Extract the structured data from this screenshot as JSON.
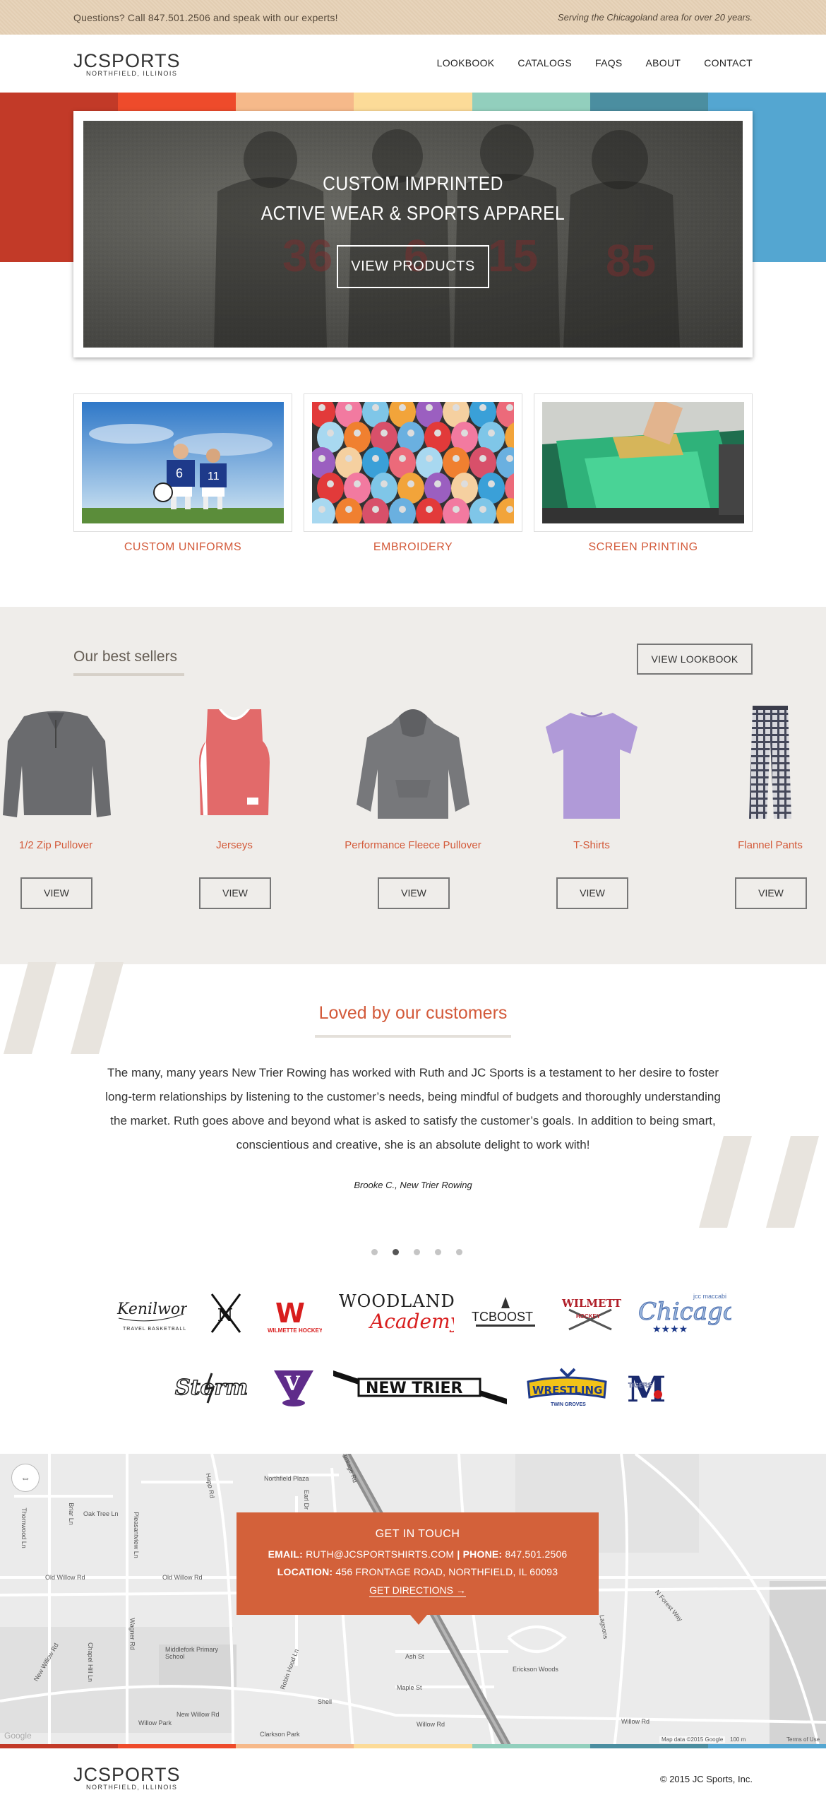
{
  "topbar": {
    "left_text": "Questions? Call 847.501.2506 and speak with our experts!",
    "right_text": "Serving the Chicagoland area for over 20 years."
  },
  "logo": {
    "main": "JCSPORTS",
    "sub": "NORTHFIELD, ILLINOIS"
  },
  "nav": [
    "LOOKBOOK",
    "CATALOGS",
    "FAQS",
    "ABOUT",
    "CONTACT"
  ],
  "stripe_colors": [
    "#c23a28",
    "#ee4b2b",
    "#f6b98a",
    "#fcdb98",
    "#92cfbd",
    "#4b8ea0",
    "#54a6d1"
  ],
  "hero": {
    "title_line1": "CUSTOM IMPRINTED",
    "title_line2": "ACTIVE WEAR & SPORTS APPAREL",
    "button": "VIEW PRODUCTS"
  },
  "services": [
    {
      "label": "CUSTOM UNIFORMS",
      "icon": "soccer-kids-image"
    },
    {
      "label": "EMBROIDERY",
      "icon": "thread-spools-image"
    },
    {
      "label": "SCREEN PRINTING",
      "icon": "screen-print-image"
    }
  ],
  "best_sellers": {
    "title": "Our best sellers",
    "lookbook_button": "VIEW LOOKBOOK",
    "products": [
      {
        "name": "1/2 Zip Pullover",
        "button": "VIEW"
      },
      {
        "name": "Jerseys",
        "button": "VIEW"
      },
      {
        "name": "Performance Fleece Pullover",
        "button": "VIEW"
      },
      {
        "name": "T-Shirts",
        "button": "VIEW"
      },
      {
        "name": "Flannel Pants",
        "button": "VIEW"
      }
    ]
  },
  "testimonial": {
    "title": "Loved by our customers",
    "text": "The many, many years New Trier Rowing has worked with Ruth and JC Sports is a testament to her desire to foster long-term relationships by listening to the customer’s needs, being mindful of budgets and thoroughly understanding the market. Ruth goes above and beyond what is asked to satisfy the customer’s goals. In addition to being smart, conscientious and creative, she is an absolute delight to work with!",
    "author": "Brooke C., New Trier Rowing",
    "active_slide": 2,
    "slide_count": 5
  },
  "clients": {
    "row1": [
      "Kenilworth",
      "TRAVEL BASKETBALL",
      "N",
      "W",
      "WILMETTE HOCKEY",
      "WOODLANDS",
      "Academy",
      "TCBOOST",
      "WILMETTE",
      "HOCKEY",
      "Chicago",
      "jcc maccabi"
    ],
    "row2": [
      "Storm",
      "V",
      "NEW TRIER",
      "WRESTLING",
      "TWIN GROVES",
      "M",
      "TIGERS"
    ]
  },
  "map": {
    "streets": [
      "Northfield Plaza",
      "Frontage Rd",
      "Happ Rd",
      "Briar Ln",
      "Oak Tree Ln",
      "Thornwood Ln",
      "Pleasantview Ln",
      "Old Willow Rd",
      "Old Willow Rd",
      "New Willow Rd",
      "Chapel Hill Ln",
      "Wagner Rd",
      "Middlefork Primary School",
      "Robin Hood Ln",
      "Ash St",
      "Maple St",
      "Shell",
      "New Willow Rd",
      "Willow Rd",
      "Erickson Woods",
      "Willow Rd",
      "N Forest Way",
      "Lagoons",
      "Clarkson Park",
      "Willow Park",
      "Earl Dr"
    ],
    "attribution": "Map data ©2015 Google",
    "scale": "100 m",
    "terms": "Terms of Use",
    "google": "Google"
  },
  "contact": {
    "heading": "GET IN TOUCH",
    "email_label": "EMAIL:",
    "email": "RUTH@JCSPORTSHIRTS.COM",
    "separator": "|",
    "phone_label": "PHONE:",
    "phone": "847.501.2506",
    "location_label": "LOCATION:",
    "location": "456 FRONTAGE ROAD, NORTHFIELD, IL 60093",
    "directions": "GET DIRECTIONS →"
  },
  "footer": {
    "copyright": "© 2015  JC Sports, Inc."
  }
}
